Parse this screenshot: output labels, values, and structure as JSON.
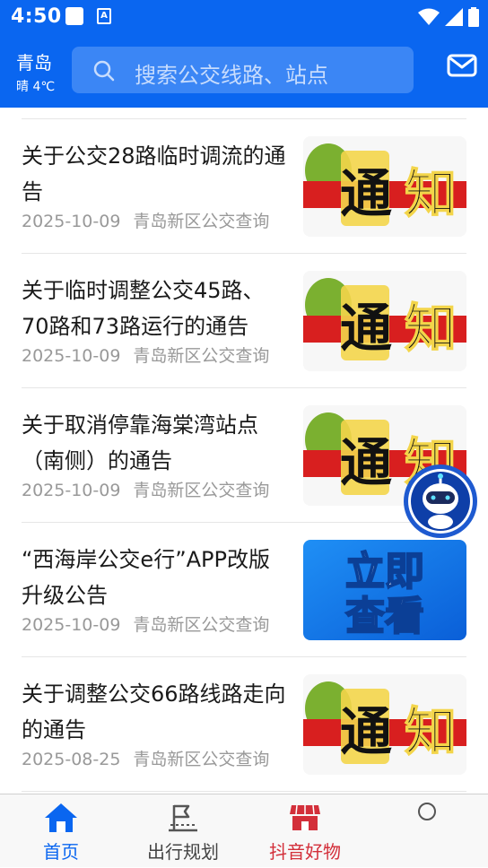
{
  "status_bar": {
    "time": "4:50",
    "notif_glyph": "A"
  },
  "header": {
    "city": "青岛",
    "weather": "晴 4℃"
  },
  "search": {
    "placeholder": "搜索公交线路、站点"
  },
  "news": [
    {
      "title": "关于公交28路临时调流的通告",
      "date": "2025-10-09",
      "source": "青岛新区公交查询",
      "thumb": "notice"
    },
    {
      "title": "关于临时调整公交45路、70路和73路运行的通告",
      "date": "2025-10-09",
      "source": "青岛新区公交查询",
      "thumb": "notice"
    },
    {
      "title": "关于取消停靠海棠湾站点（南侧）的通告",
      "date": "2025-10-09",
      "source": "青岛新区公交查询",
      "thumb": "notice"
    },
    {
      "title": "“西海岸公交e行”APP改版升级公告",
      "date": "2025-10-09",
      "source": "青岛新区公交查询",
      "thumb": "view"
    },
    {
      "title": "关于调整公交66路线路走向的通告",
      "date": "2025-08-25",
      "source": "青岛新区公交查询",
      "thumb": "notice"
    }
  ],
  "thumbs": {
    "notice_text": [
      "通",
      "知"
    ],
    "view_text": [
      "立即",
      "查看"
    ]
  },
  "tabbar": {
    "items": [
      {
        "label": "首页",
        "icon": "home-icon",
        "active": true
      },
      {
        "label": "出行规划",
        "icon": "route-plan-icon",
        "active": false
      },
      {
        "label": "抖音好物",
        "icon": "shop-icon",
        "active": false
      },
      {
        "label": "",
        "icon": "circle-icon",
        "active": false
      }
    ]
  },
  "colors": {
    "brand": "#0a66f0",
    "active_tab": "#0a66f0",
    "shop_tab": "#d32f3a",
    "meta": "#999999"
  }
}
